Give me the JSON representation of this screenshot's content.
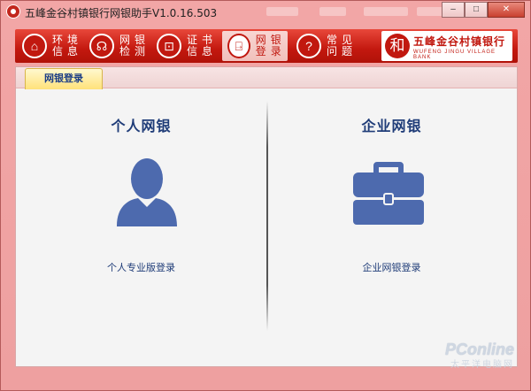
{
  "window": {
    "title": "五峰金谷村镇银行网银助手V1.0.16.503",
    "controls": {
      "minimize": "–",
      "maximize": "□",
      "close": "✕"
    }
  },
  "toolbar": {
    "items": [
      {
        "id": "env",
        "label": "环境信息",
        "icon": "home-icon"
      },
      {
        "id": "check",
        "label": "网银检测",
        "icon": "stethoscope-icon"
      },
      {
        "id": "cert",
        "label": "证书信息",
        "icon": "certificate-icon"
      },
      {
        "id": "login",
        "label": "网银登录",
        "icon": "login-door-icon",
        "active": true
      },
      {
        "id": "faq",
        "label": "常见问题",
        "icon": "question-icon"
      }
    ],
    "icon_glyphs": {
      "home": "⌂",
      "check": "☊",
      "cert": "⊡",
      "login": "⍈",
      "faq": "?"
    }
  },
  "brand": {
    "logo_char": "和",
    "name_cn": "五峰金谷村镇银行",
    "name_en": "WUFENG JINGU VILLAGE BANK"
  },
  "tabs": {
    "active_label": "网银登录"
  },
  "personal": {
    "title": "个人网银",
    "link": "个人专业版登录",
    "icon": "person-silhouette-icon"
  },
  "business": {
    "title": "企业网银",
    "link": "企业网银登录",
    "icon": "briefcase-icon"
  },
  "watermark": {
    "line1": "PConline",
    "line2": "太平洋电脑网"
  },
  "colors": {
    "brand_red": "#c1180f",
    "icon_blue": "#4d6aae",
    "text_navy": "#1f3c78",
    "tab_yellow": "#ffe27a"
  }
}
